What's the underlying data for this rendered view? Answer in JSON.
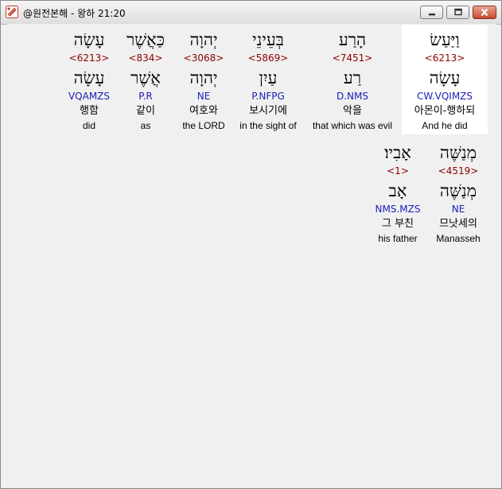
{
  "window": {
    "title": "@원전본해 - 왕하 21:20",
    "app_icon": "app-hebrew-icon",
    "controls": [
      "minimize-icon",
      "maximize-icon",
      "close-icon"
    ]
  },
  "words": [
    {
      "heb": "וַיַּעַשׂ",
      "strong": "<6213>",
      "lemma": "עָשָׂה",
      "morph": "CW.VQIMZS",
      "korean": "아몬이-행하되",
      "english": "And he did",
      "highlighted": true
    },
    {
      "heb": "הָרַע",
      "strong": "<7451>",
      "lemma": "רַע",
      "morph": "D.NMS",
      "korean": "악을",
      "english": "that which was evil"
    },
    {
      "heb": "בְּעֵינֵי",
      "strong": "<5869>",
      "lemma": "עַיִן",
      "morph": "P.NFPG",
      "korean": "보시기에",
      "english": "in the sight of"
    },
    {
      "heb": "יְהוָה",
      "strong": "<3068>",
      "lemma": "יְהוָה",
      "morph": "NE",
      "korean": "여호와",
      "english": "the LORD"
    },
    {
      "heb": "כַּאֲשֶׁר",
      "strong": "<834>",
      "lemma": "אֲשֶׁר",
      "morph": "P.R",
      "korean": "같이",
      "english": "as"
    },
    {
      "heb": "עָשָׂה",
      "strong": "<6213>",
      "lemma": "עָשָׂה",
      "morph": "VQAMZS",
      "korean": "행함",
      "english": "did"
    },
    {
      "heb": "מְנַשֶּׁה",
      "strong": "<4519>",
      "lemma": "מְנַשֶּׁה",
      "morph": "NE",
      "korean": "므낫세의",
      "english": "Manasseh"
    },
    {
      "heb": "אָבִיו׃",
      "strong": "<1>",
      "lemma": "אָב",
      "morph": "NMS.MZS",
      "korean": "그 부친",
      "english": "his father"
    }
  ]
}
